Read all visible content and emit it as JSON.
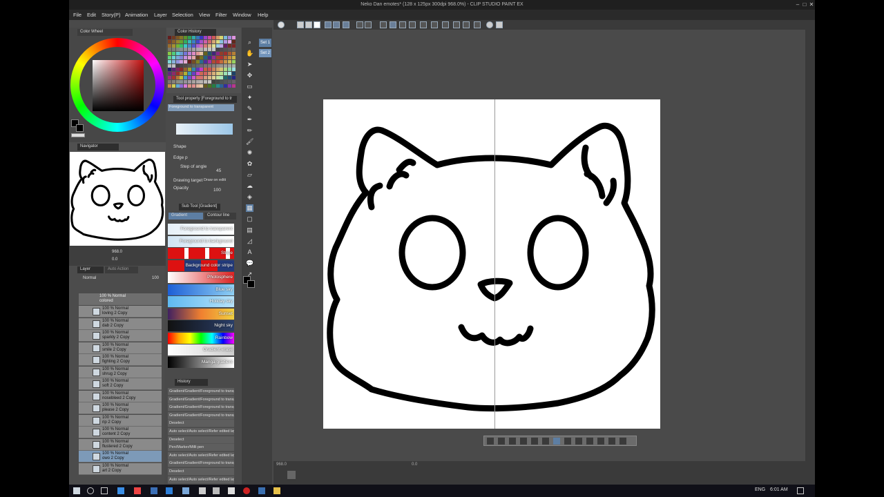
{
  "window": {
    "title": "Neko Dan emotes* (128 x 125px 300dpi 968.0%) - CLIP STUDIO PAINT EX"
  },
  "menu": [
    "File",
    "Edit",
    "Story(P)",
    "Animation",
    "Layer",
    "Selection",
    "View",
    "Filter",
    "Window",
    "Help"
  ],
  "panels": {
    "color_wheel_tab": "Color Wheel",
    "color_history_tab": "Color History",
    "navigator_tab": "Navigator",
    "tool_property_tab": "Tool property [Foreground to tr",
    "sub_tool_tab": "Sub Tool [Gradient]",
    "history_tab": "History",
    "layer_tab": "Layer",
    "auto_action_tab": "Auto Action"
  },
  "navigator": {
    "zoom": "968.0",
    "angle": "0.0"
  },
  "layer": {
    "blend_mode": "Normal",
    "opacity": "100",
    "folder": {
      "line1": "100 % Normal",
      "line2": "colored"
    },
    "rows": [
      {
        "line1": "100 % Normal",
        "line2": "loving 2 Copy"
      },
      {
        "line1": "100 % Normal",
        "line2": "dab 2 Copy"
      },
      {
        "line1": "100 % Normal",
        "line2": "sparkly 2 Copy"
      },
      {
        "line1": "100 % Normal",
        "line2": "smile 2 Copy"
      },
      {
        "line1": "100 % Normal",
        "line2": "fighting 2 Copy"
      },
      {
        "line1": "100 % Normal",
        "line2": "shrug 2 Copy"
      },
      {
        "line1": "100 % Normal",
        "line2": "soft 2 Copy"
      },
      {
        "line1": "100 % Normal",
        "line2": "nosebleed 2 Copy"
      },
      {
        "line1": "100 % Normal",
        "line2": "please 2 Copy"
      },
      {
        "line1": "100 % Normal",
        "line2": "rip 2 Copy"
      },
      {
        "line1": "100 % Normal",
        "line2": "content 2 Copy"
      },
      {
        "line1": "100 % Normal",
        "line2": "flustered 2 Copy"
      },
      {
        "line1": "100 % Normal",
        "line2": "owo 2 Copy"
      },
      {
        "line1": "100 % Normal",
        "line2": "art 2 Copy"
      }
    ]
  },
  "tool_property": {
    "preset": "Foreground to transparent",
    "shape_label": "Shape",
    "edge_label": "Edge p",
    "step_angle_label": "Step of angle",
    "step_angle_value": "45",
    "drawing_target_label": "Drawing target",
    "drawing_target_value": "Draw on editi",
    "opacity_label": "Opacity",
    "opacity_value": "100"
  },
  "sub_tool": {
    "tabs": [
      "Gradient",
      "Contour line"
    ],
    "items": [
      {
        "label": "Foreground to transparent"
      },
      {
        "label": "Foreground to background"
      },
      {
        "label": "Stripe"
      },
      {
        "label": "Background color stripe"
      },
      {
        "label": "Photosphere"
      },
      {
        "label": "Blue sky"
      },
      {
        "label": "Holiday sky"
      },
      {
        "label": "Sunset"
      },
      {
        "label": "Night sky"
      },
      {
        "label": "Rainbow"
      },
      {
        "label": "Gradient erase"
      },
      {
        "label": "Manga gradient"
      }
    ]
  },
  "history": [
    "Gradient/Gradient/Foreground to transpare",
    "Gradient/Gradient/Foreground to transpare",
    "Gradient/Gradient/Foreground to transpare",
    "Gradient/Gradient/Foreground to transpare",
    "Deselect",
    "Auto select/Auto select/Refer edited layer",
    "Deselect",
    "Pen/Marker/Milli pen",
    "Auto select/Auto select/Refer edited layer",
    "Gradient/Gradient/Foreground to transpare",
    "Deselect",
    "Auto select/Auto select/Refer edited layer"
  ],
  "toolset": [
    "Set 1",
    "Set 2"
  ],
  "statusbar": {
    "zoom": "968.0",
    "angle": "0.0"
  },
  "taskbar": {
    "lang": "ENG",
    "time": "6:01 AM"
  },
  "colors": {
    "main_color": "#000000",
    "sub_color": "#ffffff",
    "wheel_hue": "#c21010",
    "accent": "#5d7ea3"
  }
}
